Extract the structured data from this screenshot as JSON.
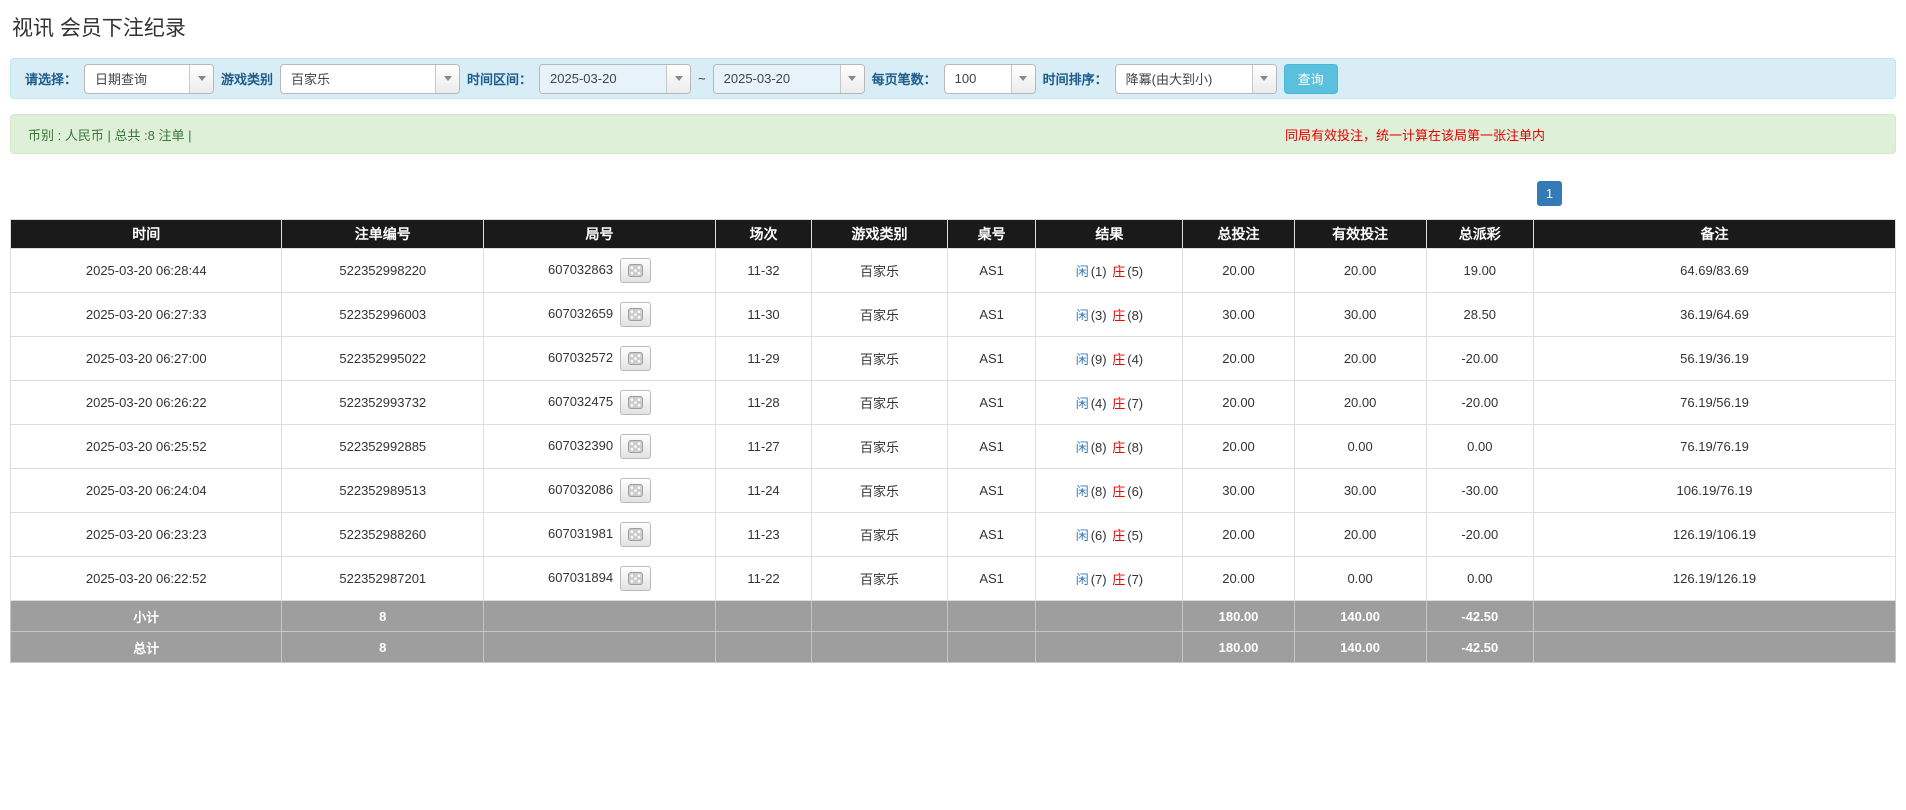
{
  "page_title": "视讯 会员下注纪录",
  "colors": {
    "accent_blue": "#337ab7",
    "notice_red": "#e60000",
    "table_header_bg": "#1a1a1a",
    "table_footer_bg": "#9e9e9e",
    "filter_bar_bg": "#d9edf7",
    "info_bar_bg": "#dff0d8",
    "query_button_bg": "#5bc0de"
  },
  "filters": {
    "select_label": "请选择：",
    "select_value": "日期查询",
    "game_label": "游戏类别",
    "game_value": "百家乐",
    "range_label": "时间区间：",
    "date_from": "2025-03-20",
    "range_separator": "~",
    "date_to": "2025-03-20",
    "page_size_label": "每页笔数：",
    "page_size_value": "100",
    "sort_label": "时间排序：",
    "sort_value": "降冪(由大到小)",
    "query_button_label": "查询"
  },
  "summary_bar": {
    "left_text": "币别 : 人民币 | 总共 :8 注单 |",
    "right_notice": "同局有效投注，统一计算在该局第一张注单内"
  },
  "pagination": {
    "page": "1"
  },
  "table": {
    "headers": [
      "时间",
      "注单编号",
      "局号",
      "场次",
      "游戏类别",
      "桌号",
      "结果",
      "总投注",
      "有效投注",
      "总派彩",
      "备注"
    ],
    "rows": [
      {
        "time": "2025-03-20 06:28:44",
        "bet_no": "522352998220",
        "round_no": "607032863",
        "session": "11-32",
        "game": "百家乐",
        "table_no": "AS1",
        "result": {
          "player": "闲",
          "player_pts": "(1)",
          "banker": "庄",
          "banker_pts": "(5)"
        },
        "total_bet": "20.00",
        "valid_bet": "20.00",
        "payout": "19.00",
        "remark": "64.69/83.69"
      },
      {
        "time": "2025-03-20 06:27:33",
        "bet_no": "522352996003",
        "round_no": "607032659",
        "session": "11-30",
        "game": "百家乐",
        "table_no": "AS1",
        "result": {
          "player": "闲",
          "player_pts": "(3)",
          "banker": "庄",
          "banker_pts": "(8)"
        },
        "total_bet": "30.00",
        "valid_bet": "30.00",
        "payout": "28.50",
        "remark": "36.19/64.69"
      },
      {
        "time": "2025-03-20 06:27:00",
        "bet_no": "522352995022",
        "round_no": "607032572",
        "session": "11-29",
        "game": "百家乐",
        "table_no": "AS1",
        "result": {
          "player": "闲",
          "player_pts": "(9)",
          "banker": "庄",
          "banker_pts": "(4)"
        },
        "total_bet": "20.00",
        "valid_bet": "20.00",
        "payout": "-20.00",
        "remark": "56.19/36.19"
      },
      {
        "time": "2025-03-20 06:26:22",
        "bet_no": "522352993732",
        "round_no": "607032475",
        "session": "11-28",
        "game": "百家乐",
        "table_no": "AS1",
        "result": {
          "player": "闲",
          "player_pts": "(4)",
          "banker": "庄",
          "banker_pts": "(7)"
        },
        "total_bet": "20.00",
        "valid_bet": "20.00",
        "payout": "-20.00",
        "remark": "76.19/56.19"
      },
      {
        "time": "2025-03-20 06:25:52",
        "bet_no": "522352992885",
        "round_no": "607032390",
        "session": "11-27",
        "game": "百家乐",
        "table_no": "AS1",
        "result": {
          "player": "闲",
          "player_pts": "(8)",
          "banker": "庄",
          "banker_pts": "(8)"
        },
        "total_bet": "20.00",
        "valid_bet": "0.00",
        "payout": "0.00",
        "remark": "76.19/76.19"
      },
      {
        "time": "2025-03-20 06:24:04",
        "bet_no": "522352989513",
        "round_no": "607032086",
        "session": "11-24",
        "game": "百家乐",
        "table_no": "AS1",
        "result": {
          "player": "闲",
          "player_pts": "(8)",
          "banker": "庄",
          "banker_pts": "(6)"
        },
        "total_bet": "30.00",
        "valid_bet": "30.00",
        "payout": "-30.00",
        "remark": "106.19/76.19"
      },
      {
        "time": "2025-03-20 06:23:23",
        "bet_no": "522352988260",
        "round_no": "607031981",
        "session": "11-23",
        "game": "百家乐",
        "table_no": "AS1",
        "result": {
          "player": "闲",
          "player_pts": "(6)",
          "banker": "庄",
          "banker_pts": "(5)"
        },
        "total_bet": "20.00",
        "valid_bet": "20.00",
        "payout": "-20.00",
        "remark": "126.19/106.19"
      },
      {
        "time": "2025-03-20 06:22:52",
        "bet_no": "522352987201",
        "round_no": "607031894",
        "session": "11-22",
        "game": "百家乐",
        "table_no": "AS1",
        "result": {
          "player": "闲",
          "player_pts": "(7)",
          "banker": "庄",
          "banker_pts": "(7)"
        },
        "total_bet": "20.00",
        "valid_bet": "0.00",
        "payout": "0.00",
        "remark": "126.19/126.19"
      }
    ],
    "footer": [
      {
        "label": "小计",
        "count": "8",
        "total_bet": "180.00",
        "valid_bet": "140.00",
        "payout": "-42.50"
      },
      {
        "label": "总计",
        "count": "8",
        "total_bet": "180.00",
        "valid_bet": "140.00",
        "payout": "-42.50"
      }
    ]
  }
}
